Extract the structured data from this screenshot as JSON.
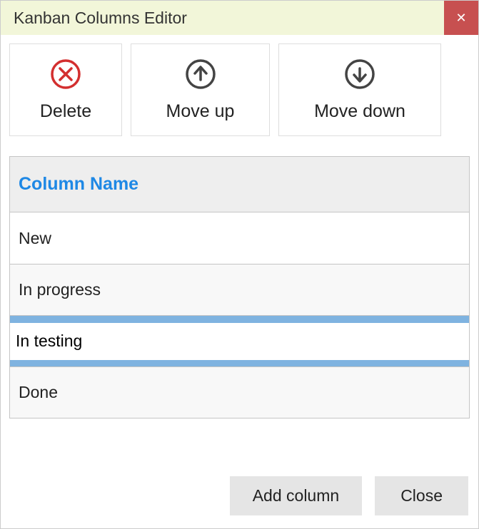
{
  "window": {
    "title": "Kanban Columns Editor",
    "close_glyph": "✕"
  },
  "toolbar": {
    "delete_label": "Delete",
    "move_up_label": "Move up",
    "move_down_label": "Move down"
  },
  "table": {
    "header": "Column Name",
    "rows": [
      {
        "value": "New"
      },
      {
        "value": "In progress"
      },
      {
        "value": "In testing",
        "editing": true
      },
      {
        "value": "Done"
      }
    ]
  },
  "footer": {
    "add_column_label": "Add column",
    "close_label": "Close"
  }
}
